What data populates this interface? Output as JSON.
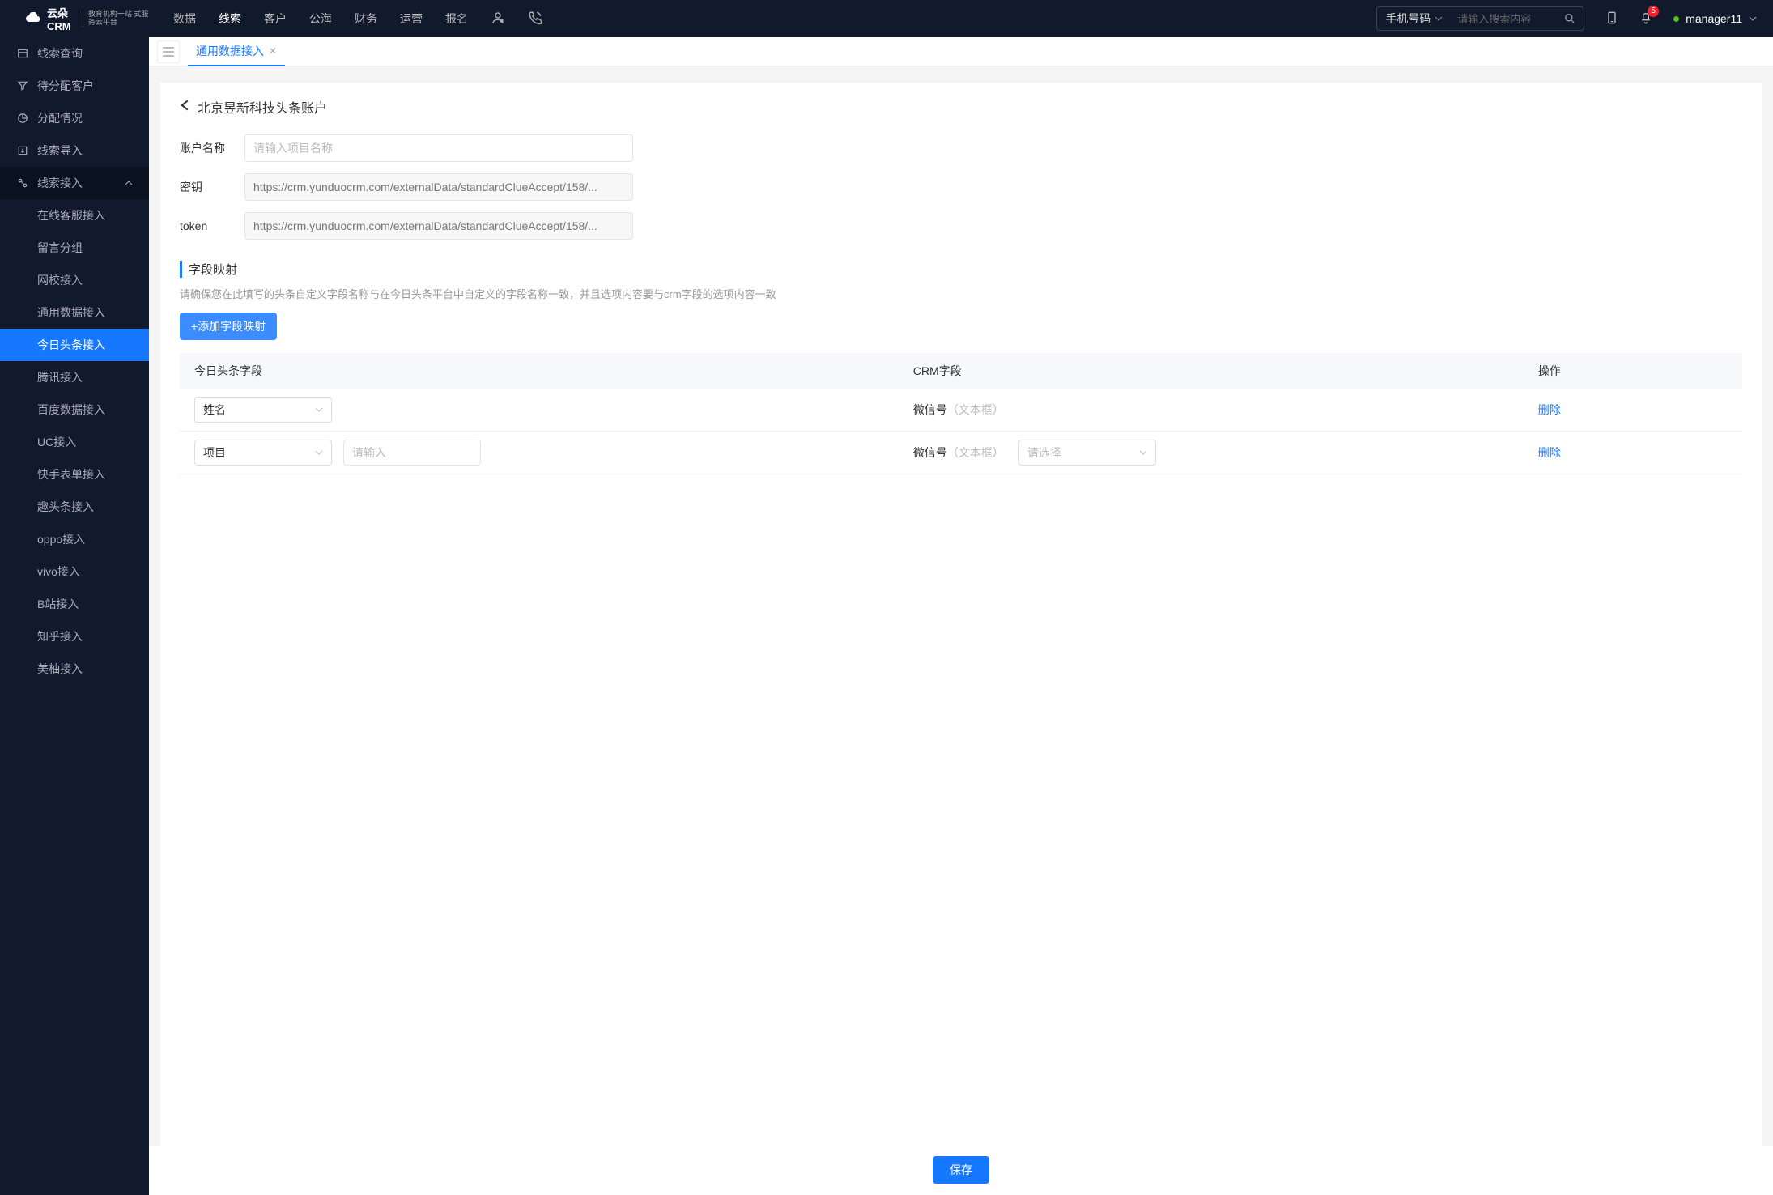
{
  "brand": {
    "name": "云朵CRM",
    "sub": "教育机构一站\n式服务云平台"
  },
  "topnav": {
    "items": [
      "数据",
      "线索",
      "客户",
      "公海",
      "财务",
      "运营",
      "报名"
    ],
    "active_index": 1
  },
  "search": {
    "filter_label": "手机号码",
    "placeholder": "请输入搜索内容"
  },
  "notifications": {
    "count": "5"
  },
  "user": {
    "name": "manager11"
  },
  "sidebar": {
    "items": [
      {
        "label": "线索查询"
      },
      {
        "label": "待分配客户"
      },
      {
        "label": "分配情况"
      },
      {
        "label": "线索导入"
      },
      {
        "label": "线索接入",
        "expanded": true,
        "children": [
          "在线客服接入",
          "留言分组",
          "网校接入",
          "通用数据接入",
          "今日头条接入",
          "腾讯接入",
          "百度数据接入",
          "UC接入",
          "快手表单接入",
          "趣头条接入",
          "oppo接入",
          "vivo接入",
          "B站接入",
          "知乎接入",
          "美柚接入"
        ],
        "selected_child_index": 4
      }
    ]
  },
  "tabs": {
    "items": [
      "通用数据接入"
    ],
    "active_index": 0
  },
  "page": {
    "title": "北京昱新科技头条账户",
    "form": {
      "account_label": "账户名称",
      "account_placeholder": "请输入项目名称",
      "secret_label": "密钥",
      "secret_value": "https://crm.yunduocrm.com/externalData/standardClueAccept/158/...",
      "token_label": "token",
      "token_value": "https://crm.yunduocrm.com/externalData/standardClueAccept/158/..."
    },
    "mapping": {
      "title": "字段映射",
      "hint": "请确保您在此填写的头条自定义字段名称与在今日头条平台中自定义的字段名称一致，并且选项内容要与crm字段的选项内容一致",
      "add_label": "+添加字段映射",
      "columns": {
        "c1": "今日头条字段",
        "c2": "CRM字段",
        "c3": "操作"
      },
      "rows": [
        {
          "tt_field": "姓名",
          "crm_field": "微信号",
          "crm_type": "（文本框）",
          "delete": "删除"
        },
        {
          "tt_field": "项目",
          "tt_extra_placeholder": "请输入",
          "crm_field": "微信号",
          "crm_type": "（文本框）",
          "crm_select_placeholder": "请选择",
          "delete": "删除"
        }
      ]
    },
    "save_label": "保存"
  }
}
